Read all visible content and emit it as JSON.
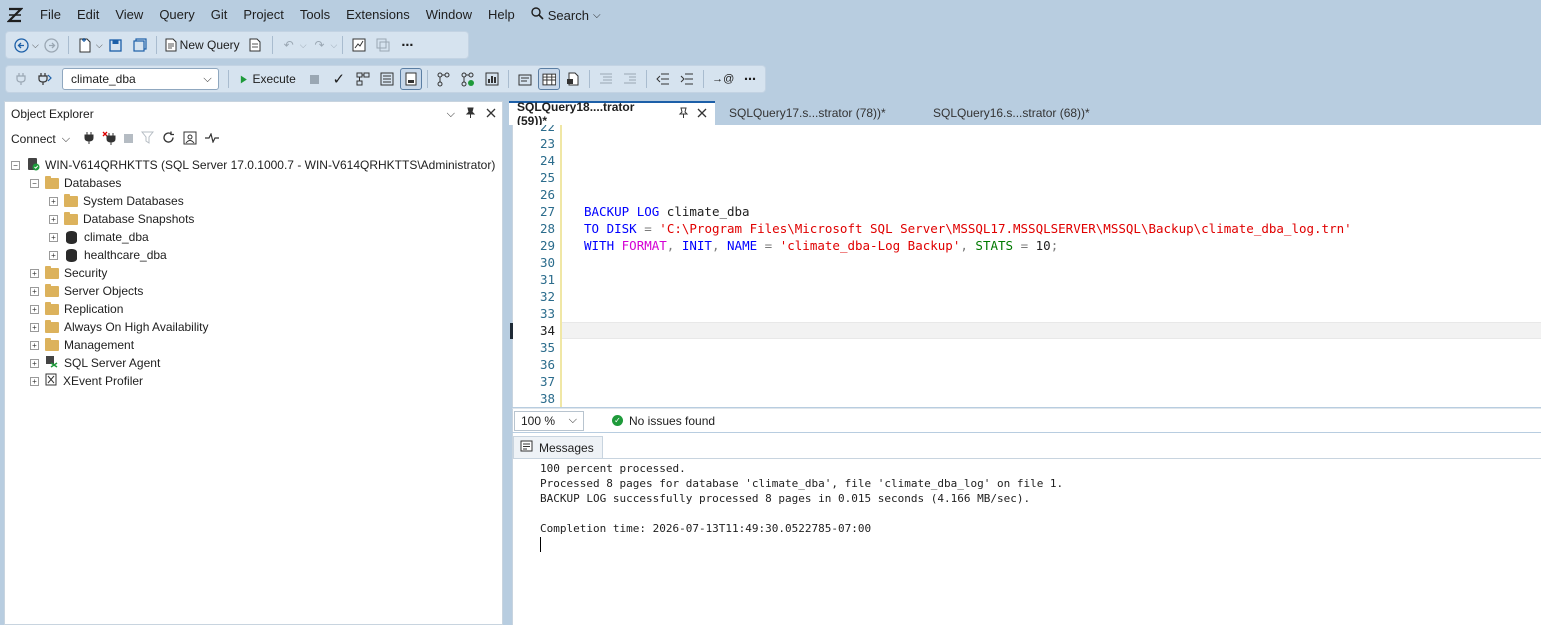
{
  "menu": [
    "File",
    "Edit",
    "View",
    "Query",
    "Git",
    "Project",
    "Tools",
    "Extensions",
    "Window",
    "Help"
  ],
  "search_label": "Search",
  "toolbar1": {
    "new_query_label": "New Query"
  },
  "toolbar2": {
    "database": "climate_dba",
    "execute_label": "Execute"
  },
  "object_explorer": {
    "title": "Object Explorer",
    "connect_label": "Connect",
    "server": "WIN-V614QRHKTTS (SQL Server 17.0.1000.7 - WIN-V614QRHKTTS\\Administrator)",
    "nodes": {
      "databases": "Databases",
      "system_databases": "System Databases",
      "database_snapshots": "Database Snapshots",
      "climate_dba": "climate_dba",
      "healthcare_dba": "healthcare_dba",
      "security": "Security",
      "server_objects": "Server Objects",
      "replication": "Replication",
      "always_on": "Always On High Availability",
      "management": "Management",
      "sql_server_agent": "SQL Server Agent",
      "xevent_profiler": "XEvent Profiler"
    }
  },
  "tabs": [
    "SQLQuery18....trator (59))*",
    "SQLQuery17.s...strator (78))*",
    "SQLQuery16.s...strator (68))*"
  ],
  "editor": {
    "line_numbers": [
      "22",
      "23",
      "24",
      "25",
      "26",
      "27",
      "28",
      "29",
      "30",
      "31",
      "32",
      "33",
      "34",
      "35",
      "36",
      "37",
      "38"
    ],
    "code": {
      "l27_kw1": "BACKUP",
      "l27_kw2": "LOG",
      "l27_db": "climate_dba",
      "l28_kw1": "TO",
      "l28_kw2": "DISK",
      "l28_eq": "=",
      "l28_str": "'C:\\Program Files\\Microsoft SQL Server\\MSSQL17.MSSQLSERVER\\MSSQL\\Backup\\climate_dba_log.trn'",
      "l29_kw1": "WITH",
      "l29_fn1": "FORMAT",
      "l29_comma1": ",",
      "l29_kw2": "INIT",
      "l29_comma2": ",",
      "l29_kw3": "NAME",
      "l29_eq": "=",
      "l29_str": "'climate_dba-Log Backup'",
      "l29_comma3": ",",
      "l29_grn": "STATS",
      "l29_eq2": "=",
      "l29_num": "10",
      "l29_semi": ";"
    }
  },
  "status": {
    "zoom": "100 %",
    "issues": "No issues found"
  },
  "messages": {
    "tab_label": "Messages",
    "lines": [
      "100 percent processed.",
      "Processed 8 pages for database 'climate_dba', file 'climate_dba_log' on file 1.",
      "BACKUP LOG successfully processed 8 pages in 0.015 seconds (4.166 MB/sec).",
      "",
      "Completion time: 2026-07-13T11:49:30.0522785-07:00"
    ]
  }
}
